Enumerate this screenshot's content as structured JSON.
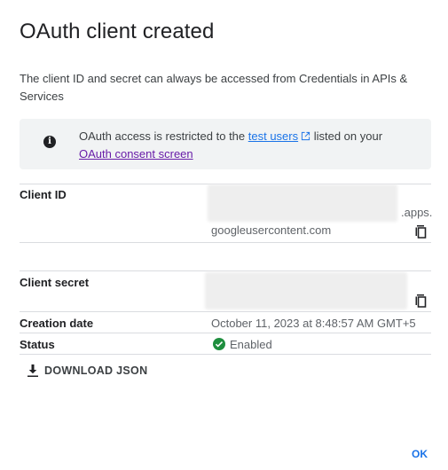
{
  "dialog": {
    "title": "OAuth client created",
    "description": "The client ID and secret can always be accessed from Credentials in APIs & Services"
  },
  "notice": {
    "icon": "info-icon",
    "text_before": "OAuth access is restricted to the ",
    "link1": "test users",
    "text_middle": " listed on your ",
    "link2": "OAuth consent screen"
  },
  "fields": {
    "client_id_label": "Client ID",
    "client_id_suffix": ".apps.",
    "client_id_domain": "googleusercontent.com",
    "client_secret_label": "Client secret",
    "creation_date_label": "Creation date",
    "creation_date_value": "October 11, 2023 at 8:48:57 AM GMT+5",
    "status_label": "Status",
    "status_value": "Enabled"
  },
  "actions": {
    "download": "DOWNLOAD JSON",
    "ok": "OK"
  },
  "colors": {
    "link": "#1a73e8",
    "visited_link": "#681da8",
    "status_ok": "#1e8e3e",
    "notice_bg": "#f1f3f4"
  }
}
